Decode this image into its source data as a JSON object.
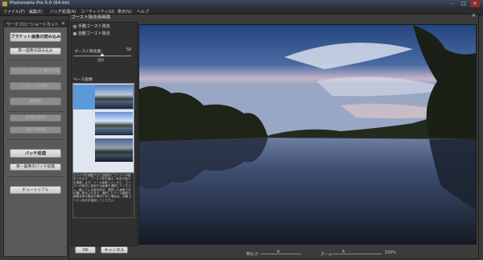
{
  "window": {
    "title": "Photomatix Pro 5.0 (64-bit)",
    "minimize": "–",
    "maximize": "□",
    "close": "✕"
  },
  "menu": [
    "ファイル(F)",
    "編集(E)",
    "バッチ処理(A)",
    "ユーティリティ(U)",
    "表示(V)",
    "ヘルプ"
  ],
  "workflow": {
    "title": "ワークフローショートカット",
    "close": "✕",
    "buttons": [
      {
        "label": "ブラケット画像の読み込み",
        "disabled": false,
        "big": true
      },
      {
        "label": "単一画像の読み込み",
        "disabled": false,
        "big": false
      },
      {
        "label": "トーンマッピング/露出合成",
        "disabled": true,
        "big": false
      },
      {
        "label": "イメージの保存",
        "disabled": true,
        "big": false
      },
      {
        "label": "再調整",
        "disabled": true,
        "big": false
      },
      {
        "label": "設定を保存",
        "disabled": true,
        "big": false
      },
      {
        "label": "設定を削除",
        "disabled": true,
        "big": false
      },
      {
        "label": "バッチ処理",
        "disabled": false,
        "big": true
      },
      {
        "label": "単一画像のバッチ処理",
        "disabled": false,
        "big": false
      },
      {
        "label": "チュートリアル",
        "disabled": false,
        "big": false
      }
    ]
  },
  "dialog": {
    "title": "ゴースト除去用画像",
    "close": "✕",
    "mode_manual": "手動ゴースト除去",
    "mode_auto": "自動ゴースト除去",
    "selected_mode": "auto",
    "ghost_amount_label": "ゴースト除去量:",
    "ghost_amount_value": "50",
    "ghost_amount_level": "通常",
    "base_image_label": "ベース画像",
    "selected_base_index": 0,
    "description": "スライダを調整すると自動的にゴーストが除去されます。ゴースト除去量は、除去の強さを調整します。ベース画像リストから、ゴーストの除去に使用する画像を選択してください。動いている被写体が、選択した画像での位置に表示されます。選択したベース画像で画像全体の露出が適切でない場合は、手動ゴースト除去を使用してください。",
    "ok_label": "OK",
    "cancel_label": "キャンセル"
  },
  "preview": {
    "brightness_label": "明るさ:",
    "brightness_value": "A",
    "zoom_label": "ズーム:",
    "zoom_marker": "A",
    "zoom_value": "100%"
  },
  "colors": {
    "sky_top": "#2f4f8c",
    "sky_horizon": "#c9b8c8",
    "accent_select": "#5a9ad8"
  }
}
